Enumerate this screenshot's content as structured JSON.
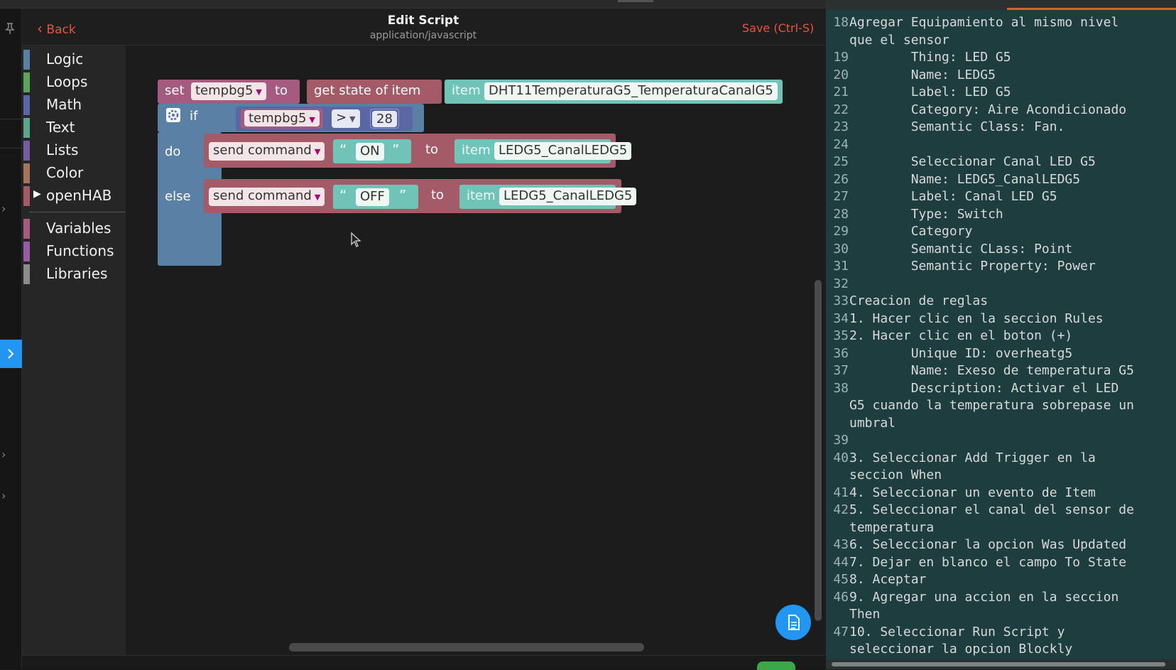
{
  "nav": {
    "back_label": "Back",
    "title": "Edit Script",
    "subtitle": "application/javascript",
    "save_label": "Save (Ctrl-S)"
  },
  "toolbox": {
    "categories": [
      {
        "label": "Logic",
        "color": "#5b80a5"
      },
      {
        "label": "Loops",
        "color": "#5ba55b"
      },
      {
        "label": "Math",
        "color": "#5b67a5"
      },
      {
        "label": "Text",
        "color": "#5ba58c"
      },
      {
        "label": "Lists",
        "color": "#745ba5"
      },
      {
        "label": "Color",
        "color": "#a5745b"
      },
      {
        "label": "openHAB",
        "color": "#a55b67"
      },
      {
        "label": "Variables",
        "color": "#a55b80"
      },
      {
        "label": "Functions",
        "color": "#995ba5"
      },
      {
        "label": "Libraries",
        "color": "#8c8c8c"
      }
    ]
  },
  "blocks": {
    "set_kw": "set",
    "var_name": "tempbg5",
    "to_kw": "to",
    "get_state": "get state of item",
    "item_kw": "item",
    "sensor_item": "DHT11TemperaturaG5_TemperaturaCanalG5",
    "if_kw": "if",
    "op": ">",
    "threshold": "28",
    "do_kw": "do",
    "else_kw": "else",
    "send_cmd": "send command",
    "on_val": "ON",
    "off_val": "OFF",
    "led_item": "LEDG5_CanalLEDG5",
    "open_quote": "“",
    "close_quote": "”"
  },
  "colors": {
    "accent": "#e8553f",
    "var_block": "#a55b80",
    "openhab_block": "#a55b67",
    "logic_block": "#5b80a5",
    "text_block": "#5ba58c",
    "math_block": "#5b67a5",
    "editor_bg": "#1e3d3f"
  },
  "editor": {
    "lines": [
      {
        "n": "18",
        "t": "Agregar Equipamiento al mismo nivel"
      },
      {
        "n": "",
        "t": "que el sensor"
      },
      {
        "n": "19",
        "t": "        Thing: LED G5"
      },
      {
        "n": "20",
        "t": "        Name: LEDG5"
      },
      {
        "n": "21",
        "t": "        Label: LED G5"
      },
      {
        "n": "22",
        "t": "        Category: Aire Acondicionado"
      },
      {
        "n": "23",
        "t": "        Semantic Class: Fan."
      },
      {
        "n": "24",
        "t": ""
      },
      {
        "n": "25",
        "t": "        Seleccionar Canal LED G5"
      },
      {
        "n": "26",
        "t": "        Name: LEDG5_CanalLEDG5"
      },
      {
        "n": "27",
        "t": "        Label: Canal LED G5"
      },
      {
        "n": "28",
        "t": "        Type: Switch"
      },
      {
        "n": "29",
        "t": "        Category"
      },
      {
        "n": "30",
        "t": "        Semantic CLass: Point"
      },
      {
        "n": "31",
        "t": "        Semantic Property: Power"
      },
      {
        "n": "32",
        "t": ""
      },
      {
        "n": "33",
        "t": "Creacion de reglas"
      },
      {
        "n": "34",
        "t": "1. Hacer clic en la seccion Rules"
      },
      {
        "n": "35",
        "t": "2. Hacer clic en el boton (+)"
      },
      {
        "n": "36",
        "t": "        Unique ID: overheatg5"
      },
      {
        "n": "37",
        "t": "        Name: Exeso de temperatura G5"
      },
      {
        "n": "38",
        "t": "        Description: Activar el LED"
      },
      {
        "n": "",
        "t": "G5 cuando la temperatura sobrepase un"
      },
      {
        "n": "",
        "t": "umbral"
      },
      {
        "n": "39",
        "t": ""
      },
      {
        "n": "40",
        "t": "3. Seleccionar Add Trigger en la"
      },
      {
        "n": "",
        "t": "seccion When"
      },
      {
        "n": "41",
        "t": "4. Seleccionar un evento de Item"
      },
      {
        "n": "42",
        "t": "5. Seleccionar el canal del sensor de"
      },
      {
        "n": "",
        "t": "temperatura"
      },
      {
        "n": "43",
        "t": "6. Seleccionar la opcion Was Updated"
      },
      {
        "n": "44",
        "t": "7. Dejar en blanco el campo To State"
      },
      {
        "n": "45",
        "t": "8. Aceptar"
      },
      {
        "n": "46",
        "t": "9. Agregar una accion en la seccion"
      },
      {
        "n": "",
        "t": "Then"
      },
      {
        "n": "47",
        "t": "10. Seleccionar Run Script y"
      },
      {
        "n": "",
        "t": "seleccionar la opcion Blockly"
      }
    ]
  }
}
